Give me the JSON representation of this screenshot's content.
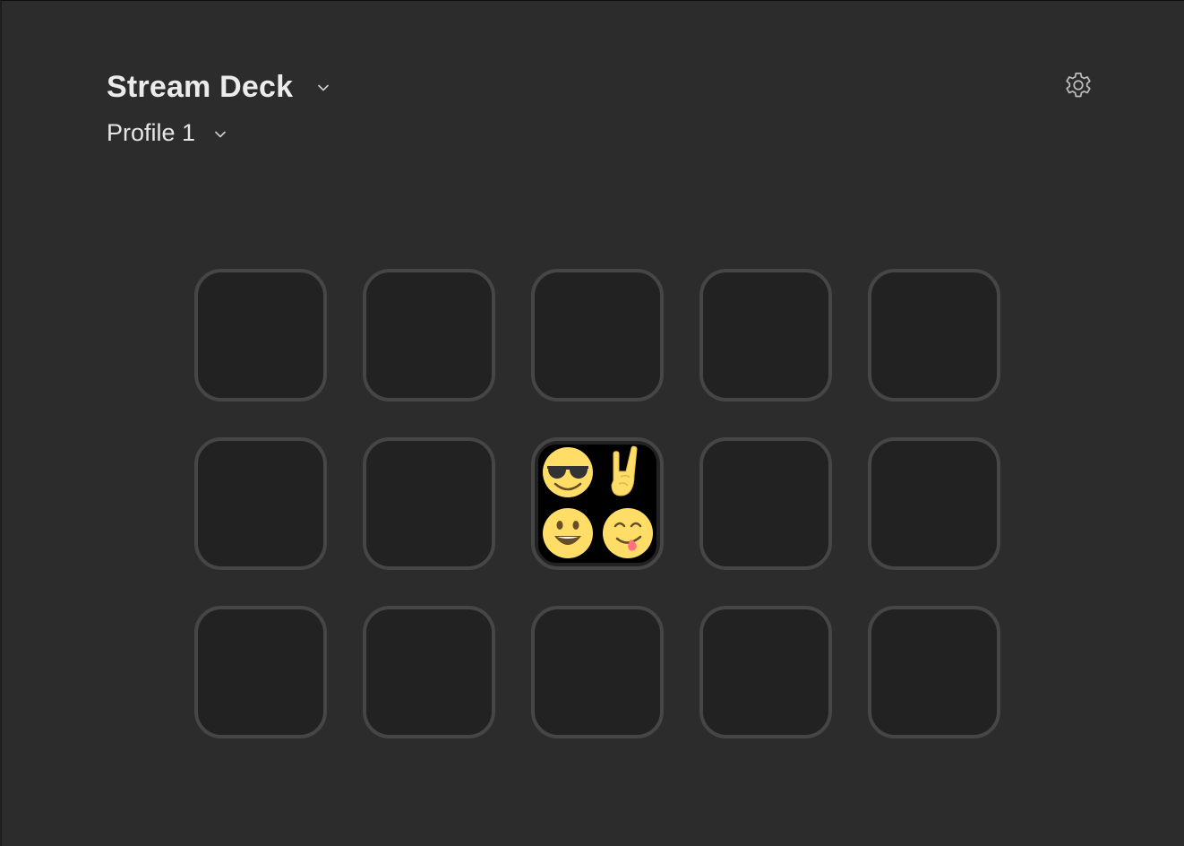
{
  "header": {
    "device_name": "Stream Deck",
    "profile_name": "Profile 1"
  },
  "settings": {
    "icon": "gear-icon"
  },
  "grid": {
    "rows": 3,
    "columns": 5,
    "keys": [
      {
        "position": 1,
        "assigned": false
      },
      {
        "position": 2,
        "assigned": false
      },
      {
        "position": 3,
        "assigned": false
      },
      {
        "position": 4,
        "assigned": false
      },
      {
        "position": 5,
        "assigned": false
      },
      {
        "position": 6,
        "assigned": false
      },
      {
        "position": 7,
        "assigned": false
      },
      {
        "position": 8,
        "assigned": true,
        "icon": "emoji-collection-icon",
        "emojis": [
          "smiling-face-with-sunglasses",
          "sign-of-the-horns",
          "grinning-face",
          "face-savoring-food"
        ]
      },
      {
        "position": 9,
        "assigned": false
      },
      {
        "position": 10,
        "assigned": false
      },
      {
        "position": 11,
        "assigned": false
      },
      {
        "position": 12,
        "assigned": false
      },
      {
        "position": 13,
        "assigned": false
      },
      {
        "position": 14,
        "assigned": false
      },
      {
        "position": 15,
        "assigned": false
      }
    ]
  },
  "colors": {
    "background": "#2c2c2c",
    "key_border": "#464646",
    "key_fill": "#222222",
    "emoji_yellow": "#ffdd67"
  }
}
